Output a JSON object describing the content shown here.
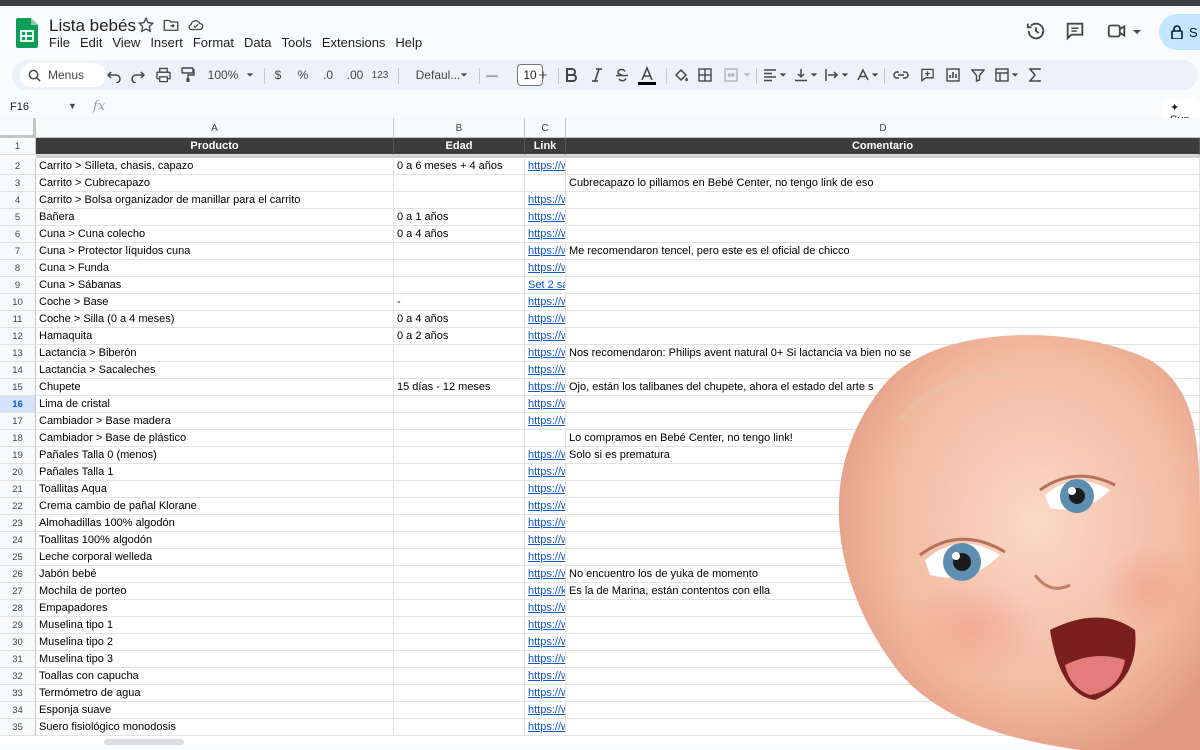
{
  "title": {
    "doc_name": "Lista bebés"
  },
  "menu": [
    "File",
    "Edit",
    "View",
    "Insert",
    "Format",
    "Data",
    "Tools",
    "Extensions",
    "Help"
  ],
  "share_label": "S",
  "toolbar": {
    "menus_label": "Menus",
    "zoom": "100%",
    "currency": "$",
    "percent": "%",
    "dec_decrease": ".0",
    "dec_increase": ".00",
    "number_format": "123",
    "font": "Defaul...",
    "font_size": "10",
    "minus": "—",
    "plus": "+"
  },
  "formula_bar": {
    "cell_ref": "F16",
    "fx": "fx",
    "sum_label": "Sun"
  },
  "columns": [
    "A",
    "B",
    "C",
    "D"
  ],
  "headers": {
    "a": "Producto",
    "b": "Edad",
    "c": "Link",
    "d": "Comentario"
  },
  "rows": [
    {
      "n": "2",
      "a": "Carrito > Silleta, chasis, capazo",
      "b": "0 a 6 meses + 4 años",
      "c": "https://w",
      "d": ""
    },
    {
      "n": "3",
      "a": "Carrito > Cubrecapazo",
      "b": "",
      "c": "",
      "d": "Cubrecapazo lo pillamos en Bebé Center, no tengo link de eso"
    },
    {
      "n": "4",
      "a": "Carrito > Bolsa organizador de manillar para el carrito",
      "b": "",
      "c": "https://w",
      "d": ""
    },
    {
      "n": "5",
      "a": "Bañera",
      "b": "0 a 1 años",
      "c": "https://w",
      "d": ""
    },
    {
      "n": "6",
      "a": "Cuna > Cuna colecho",
      "b": "0 a 4 años",
      "c": "https://w",
      "d": ""
    },
    {
      "n": "7",
      "a": "Cuna > Protector líquidos cuna",
      "b": "",
      "c": "https://w",
      "d": "Me recomendaron tencel, pero este es el oficial de chicco"
    },
    {
      "n": "8",
      "a": "Cuna > Funda",
      "b": "",
      "c": "https://w",
      "d": ""
    },
    {
      "n": "9",
      "a": "Cuna > Sábanas",
      "b": "",
      "c": "Set 2 sá",
      "d": ""
    },
    {
      "n": "10",
      "a": "Coche > Base",
      "b": "-",
      "c": "https://w",
      "d": ""
    },
    {
      "n": "11",
      "a": "Coche > Silla (0 a 4 meses)",
      "b": "0 a 4 años",
      "c": "https://w",
      "d": ""
    },
    {
      "n": "12",
      "a": "Hamaquita",
      "b": "0 a 2 años",
      "c": "https://w",
      "d": ""
    },
    {
      "n": "13",
      "a": "Lactancia > Biberón",
      "b": "",
      "c": "https://w",
      "d": "Nos recomendaron: Philips avent natural 0+ Si lactancia va bien no se"
    },
    {
      "n": "14",
      "a": "Lactancia > Sacaleches",
      "b": "",
      "c": "https://w",
      "d": ""
    },
    {
      "n": "15",
      "a": "Chupete",
      "b": "15 días - 12 meses",
      "c": "https://w",
      "d": "Ojo, están los talibanes del chupete, ahora el estado del arte s"
    },
    {
      "n": "16",
      "a": "Lima de cristal",
      "b": "",
      "c": "https://w",
      "d": ""
    },
    {
      "n": "17",
      "a": "Cambiador > Base madera",
      "b": "",
      "c": "https://w",
      "d": ""
    },
    {
      "n": "18",
      "a": "Cambiador > Base de plástico",
      "b": "",
      "c": "",
      "d": "Lo compramos en Bebé Center, no tengo link!"
    },
    {
      "n": "19",
      "a": "Pañales Talla 0 (menos)",
      "b": "",
      "c": "https://w",
      "d": "Solo si es prematura"
    },
    {
      "n": "20",
      "a": "Pañales Talla 1",
      "b": "",
      "c": "https://w",
      "d": ""
    },
    {
      "n": "21",
      "a": "Toallitas Aqua",
      "b": "",
      "c": "https://w",
      "d": ""
    },
    {
      "n": "22",
      "a": "Crema cambio de pañal Klorane",
      "b": "",
      "c": "https://w",
      "d": ""
    },
    {
      "n": "23",
      "a": "Almohadillas 100% algodón",
      "b": "",
      "c": "https://w",
      "d": ""
    },
    {
      "n": "24",
      "a": "Toallitas 100% algodón",
      "b": "",
      "c": "https://w",
      "d": ""
    },
    {
      "n": "25",
      "a": "Leche corporal welleda",
      "b": "",
      "c": "https://w",
      "d": ""
    },
    {
      "n": "26",
      "a": "Jabón bebé",
      "b": "",
      "c": "https://w",
      "d": "No encuentro los de yuka de momento"
    },
    {
      "n": "27",
      "a": "Mochila de porteo",
      "b": "",
      "c": "https://k",
      "d": "Es la de Marina, están contentos con ella"
    },
    {
      "n": "28",
      "a": "Empapadores",
      "b": "",
      "c": "https://w",
      "d": ""
    },
    {
      "n": "29",
      "a": "Muselina tipo 1",
      "b": "",
      "c": "https://w",
      "d": ""
    },
    {
      "n": "30",
      "a": "Muselina tipo 2",
      "b": "",
      "c": "https://w",
      "d": ""
    },
    {
      "n": "31",
      "a": "Muselina tipo 3",
      "b": "",
      "c": "https://w",
      "d": ""
    },
    {
      "n": "32",
      "a": "Toallas con capucha",
      "b": "",
      "c": "https://w",
      "d": ""
    },
    {
      "n": "33",
      "a": "Termómetro de agua",
      "b": "",
      "c": "https://w",
      "d": ""
    },
    {
      "n": "34",
      "a": "Esponja suave",
      "b": "",
      "c": "https://w",
      "d": ""
    },
    {
      "n": "35",
      "a": "Suero fisiológico monodosis",
      "b": "",
      "c": "https://w",
      "d": ""
    }
  ],
  "active_row": "16",
  "colors": {
    "header_bg": "#3c3c3c",
    "link": "#1155cc",
    "sheets_green": "#0f9d58"
  }
}
